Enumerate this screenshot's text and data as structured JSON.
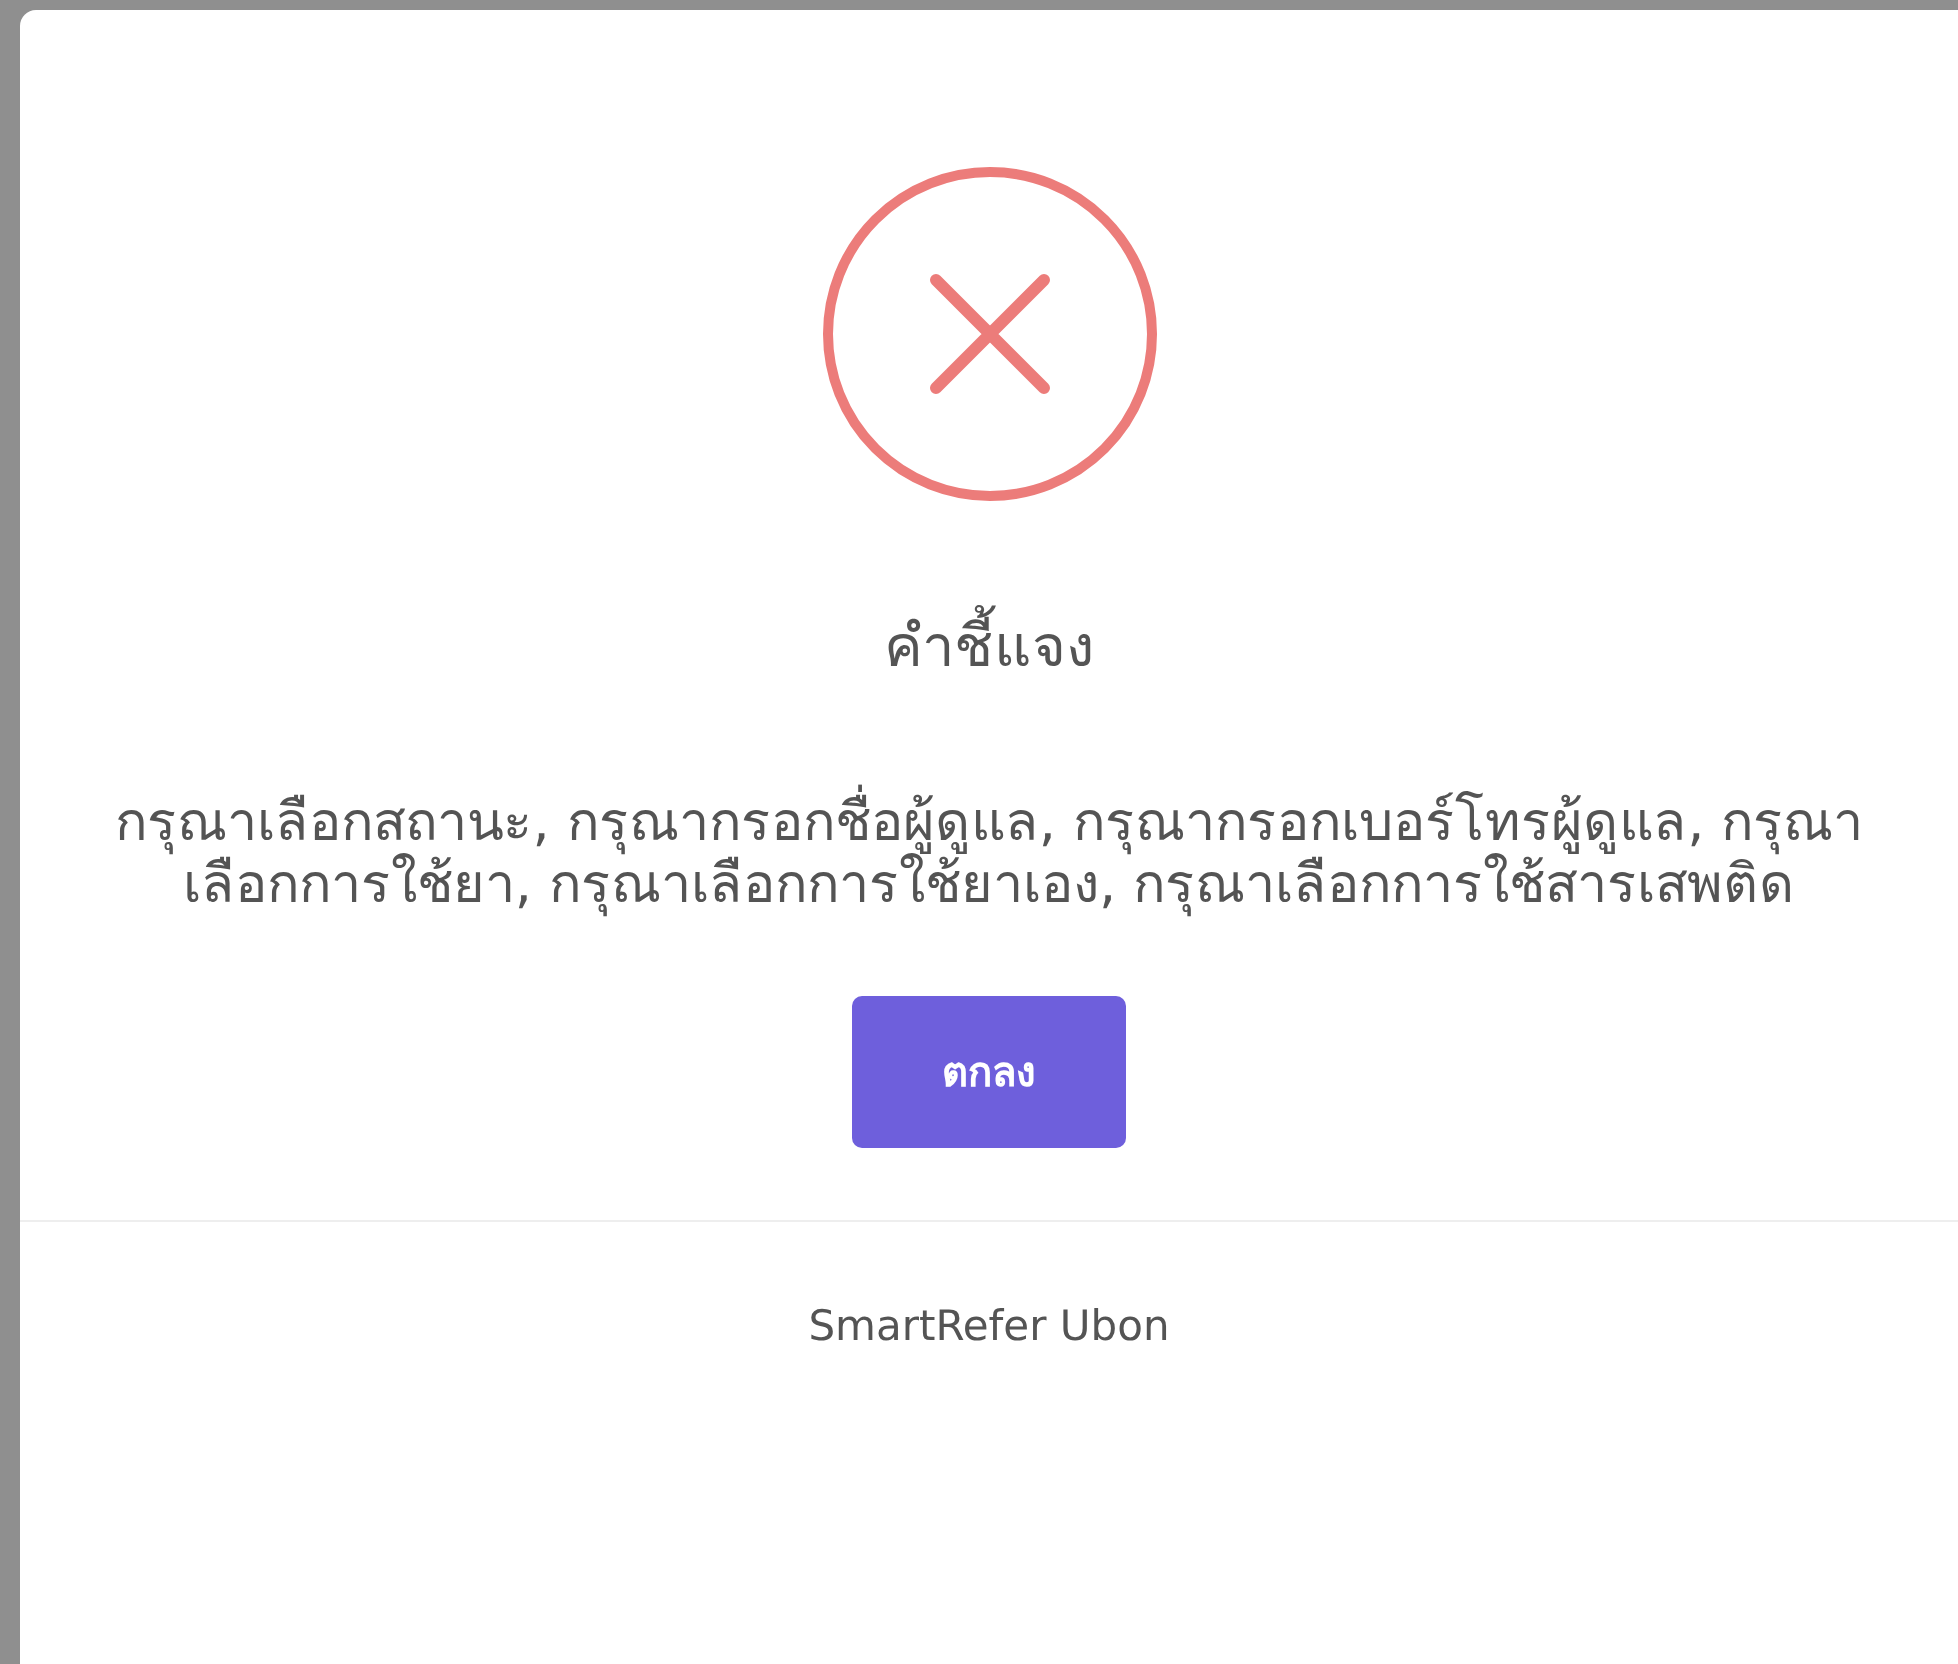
{
  "dialog": {
    "kind": "error",
    "title": "คำชี้แจง",
    "message": "กรุณาเลือกสถานะ, กรุณากรอกชื่อผู้ดูแล, กรุณากรอกเบอร์โทรผู้ดูแล, กรุณาเลือกการใช้ยา, กรุณาเลือกการใช้ยาเอง, กรุณาเลือกการใช้สารเสพติด",
    "confirm_button": "ตกลง",
    "footer": "SmartRefer Ubon"
  }
}
